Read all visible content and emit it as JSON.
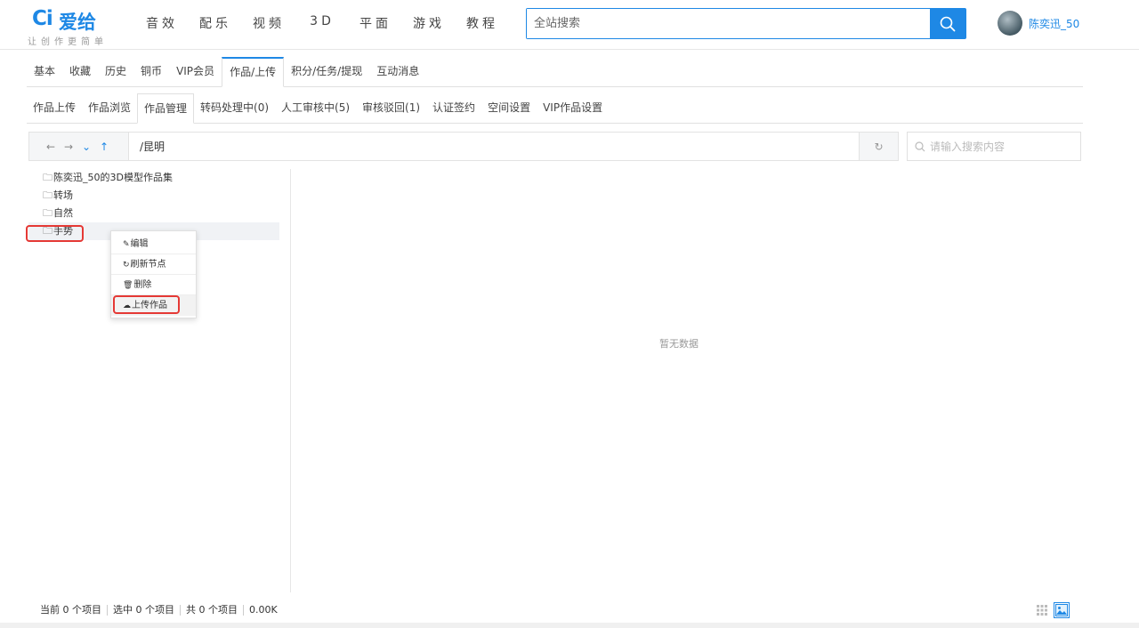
{
  "header": {
    "logo_mark": "Ci",
    "logo_text": "爱给",
    "slogan": "让创作更简单",
    "nav": [
      "音效",
      "配乐",
      "视频",
      "3D",
      "平面",
      "游戏",
      "教程"
    ],
    "search_placeholder": "全站搜索",
    "user_name": "陈奕迅_50"
  },
  "tabs_primary": [
    "基本",
    "收藏",
    "历史",
    "铜币",
    "VIP会员",
    "作品/上传",
    "积分/任务/提现",
    "互动消息"
  ],
  "tabs_primary_active": "作品/上传",
  "tabs_secondary": [
    "作品上传",
    "作品浏览",
    "作品管理",
    "转码处理中(0)",
    "人工审核中(5)",
    "审核驳回(1)",
    "认证签约",
    "空间设置",
    "VIP作品设置"
  ],
  "tabs_secondary_active": "作品管理",
  "path": "/昆明",
  "file_search_placeholder": "请输入搜索内容",
  "tree": [
    "陈奕迅_50的3D模型作品集",
    "转场",
    "自然",
    "手势"
  ],
  "context_menu": [
    "编辑",
    "刷新节点",
    "删除",
    "上传作品"
  ],
  "empty_text": "暂无数据",
  "status": {
    "current": "当前 0 个项目",
    "selected": "选中 0 个项目",
    "total": "共 0 个项目",
    "size": "0.00K"
  },
  "colors": {
    "accent": "#1e88e5",
    "highlight_box": "#e53935"
  }
}
